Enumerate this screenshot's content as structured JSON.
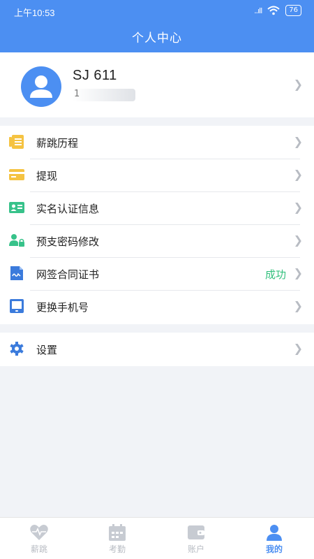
{
  "status_bar": {
    "time": "上午10:53",
    "signal": "..ıll",
    "battery": "76"
  },
  "header": {
    "title": "个人中心"
  },
  "profile": {
    "username": "SJ 611",
    "phone_masked": "1"
  },
  "menu_group_1": [
    {
      "label": "薪跳历程",
      "icon": "file-list-icon"
    },
    {
      "label": "提现",
      "icon": "bank-card-icon"
    },
    {
      "label": "实名认证信息",
      "icon": "id-card-icon"
    },
    {
      "label": "预支密码修改",
      "icon": "user-lock-icon"
    },
    {
      "label": "网签合同证书",
      "icon": "contract-icon",
      "status": "成功"
    },
    {
      "label": "更换手机号",
      "icon": "tablet-icon"
    }
  ],
  "menu_group_2": [
    {
      "label": "设置",
      "icon": "gear-icon"
    }
  ],
  "tabs": [
    {
      "label": "薪跳",
      "icon": "heartbeat-icon",
      "active": false
    },
    {
      "label": "考勤",
      "icon": "calendar-icon",
      "active": false
    },
    {
      "label": "账户",
      "icon": "wallet-icon",
      "active": false
    },
    {
      "label": "我的",
      "icon": "person-icon",
      "active": true
    }
  ],
  "colors": {
    "primary": "#4c8ff2",
    "success": "#33c07d",
    "icon_yellow": "#f5c342",
    "icon_green": "#37c28a",
    "icon_blue": "#3b7bdc",
    "inactive": "#b8bcc3"
  }
}
